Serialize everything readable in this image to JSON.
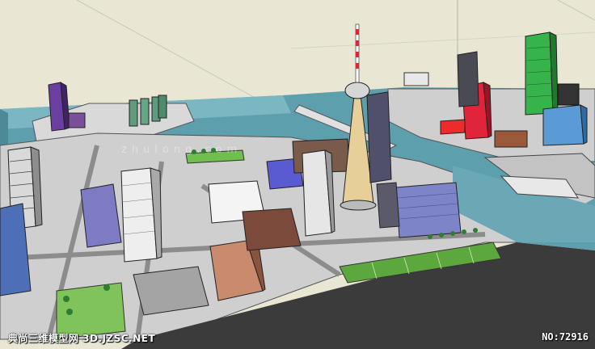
{
  "watermark": {
    "site": "典尚三维模型网 3D.JZSC.NET",
    "model_number": "NO:72916",
    "center_mark": "zhulong.com"
  },
  "colors": {
    "sky": "#e9e7d4",
    "water": "#5e9fae",
    "base": "#3b3b3b",
    "tower_shaft": "#e6cf98"
  }
}
